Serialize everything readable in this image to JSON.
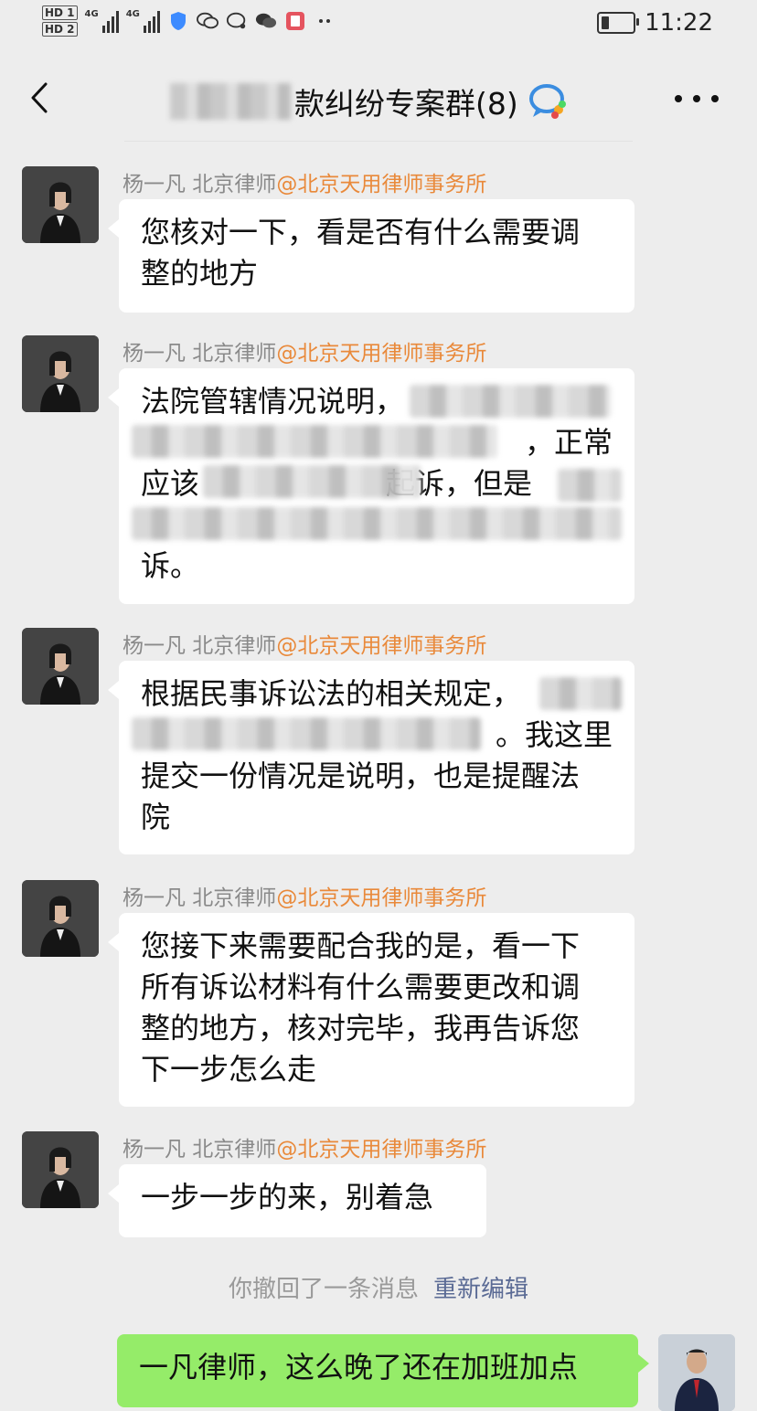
{
  "status_bar": {
    "hd1": "HD 1",
    "hd2": "HD 2",
    "net1": "4G",
    "net2": "4G",
    "time": "11:22",
    "icons": [
      "shield-icon",
      "wechat-icon",
      "chat-bubble-icon",
      "wechat-icon",
      "app-icon",
      "more-dots-icon"
    ]
  },
  "header": {
    "title": "款纠纷专案群(8)"
  },
  "messages": [
    {
      "sender_name": "杨一凡 北京律师",
      "sender_org": "@北京天用律师事务所",
      "lines": [
        "您核对一下，看是否有什么需要调",
        "整的地方"
      ]
    },
    {
      "sender_name": "杨一凡 北京律师",
      "sender_org": "@北京天用律师事务所",
      "lines": [
        "法院管辖情况说明，",
        "，正常",
        "应该",
        "起诉，但是",
        "诉。"
      ]
    },
    {
      "sender_name": "杨一凡 北京律师",
      "sender_org": "@北京天用律师事务所",
      "lines": [
        "根据民事诉讼法的相关规定，",
        "。我这里",
        "提交一份情况是说明，也是提醒法",
        "院"
      ]
    },
    {
      "sender_name": "杨一凡 北京律师",
      "sender_org": "@北京天用律师事务所",
      "lines": [
        "您接下来需要配合我的是，看一下",
        "所有诉讼材料有什么需要更改和调",
        "整的地方，核对完毕，我再告诉您",
        "下一步怎么走"
      ]
    },
    {
      "sender_name": "杨一凡 北京律师",
      "sender_org": "@北京天用律师事务所",
      "lines": [
        "一步一步的来，别着急"
      ]
    }
  ],
  "recall": {
    "text": "你撤回了一条消息",
    "edit_label": "重新编辑"
  },
  "my_message": {
    "text": "一凡律师，这么晚了还在加班加点"
  },
  "colors": {
    "background": "#ededed",
    "org_accent": "#e9893a",
    "my_bubble": "#95ec69",
    "edit_link": "#5b6b95"
  }
}
